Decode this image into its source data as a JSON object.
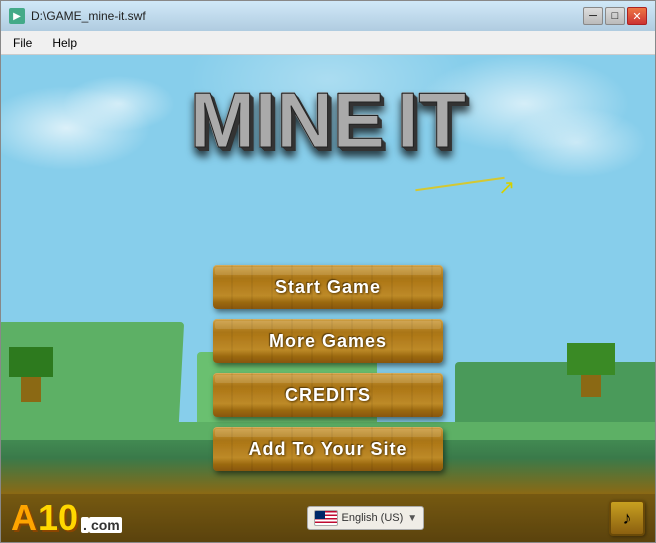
{
  "window": {
    "title": "D:\\GAME_mine-it.swf",
    "icon_label": "SWF"
  },
  "menu": {
    "items": [
      "File",
      "Help"
    ]
  },
  "logo": {
    "line1": "MINE",
    "line2": "IT"
  },
  "buttons": [
    {
      "id": "start-game",
      "label": "Start Game"
    },
    {
      "id": "more-games",
      "label": "More Games"
    },
    {
      "id": "credits",
      "label": "CREDITS"
    },
    {
      "id": "add-site",
      "label": "Add To Your Site"
    }
  ],
  "bottom": {
    "a10_logo": "A10",
    "a10_com": ".com",
    "lang_text": "English (US)",
    "music_icon": "♪"
  }
}
